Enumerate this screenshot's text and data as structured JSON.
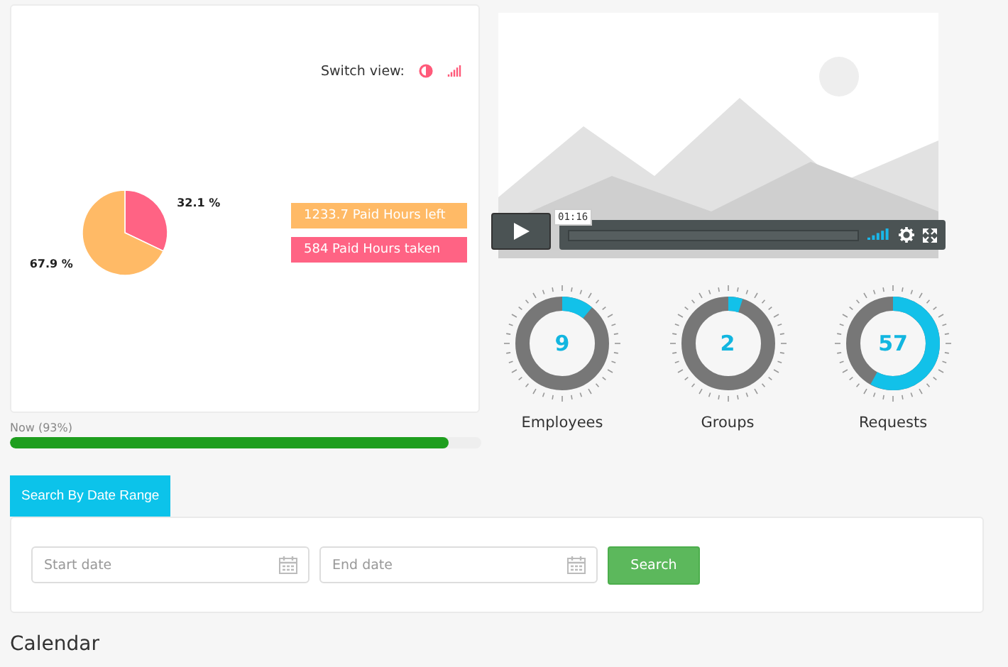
{
  "report": {
    "switch_label": "Switch view:",
    "chart_data": {
      "type": "pie",
      "values": [
        32.1,
        67.9
      ],
      "colors": [
        "#ff6384",
        "#ffba66"
      ],
      "data_labels": true,
      "value_labels": [
        "32.1 %",
        "67.9 %"
      ]
    },
    "legend": [
      {
        "label": "1233.7 Paid Hours left",
        "color": "#ffba66"
      },
      {
        "label": "584 Paid Hours taken",
        "color": "#ff6384"
      }
    ]
  },
  "progress": {
    "label": "Now (93%)",
    "level": 0.93
  },
  "video": {
    "kind": "picture",
    "time": "01:16"
  },
  "gauges": [
    {
      "value": "9",
      "label": "Employees",
      "level": 0.11
    },
    {
      "value": "2",
      "label": "Groups",
      "level": 0.05
    },
    {
      "value": "57",
      "label": "Requests",
      "level": 0.58
    }
  ],
  "date_search": {
    "tab": "Search By Date Range",
    "start": {
      "placeholder": "Start date"
    },
    "end": {
      "placeholder": "End date"
    },
    "button": "Search"
  },
  "calendar": {
    "heading": "Calendar"
  }
}
